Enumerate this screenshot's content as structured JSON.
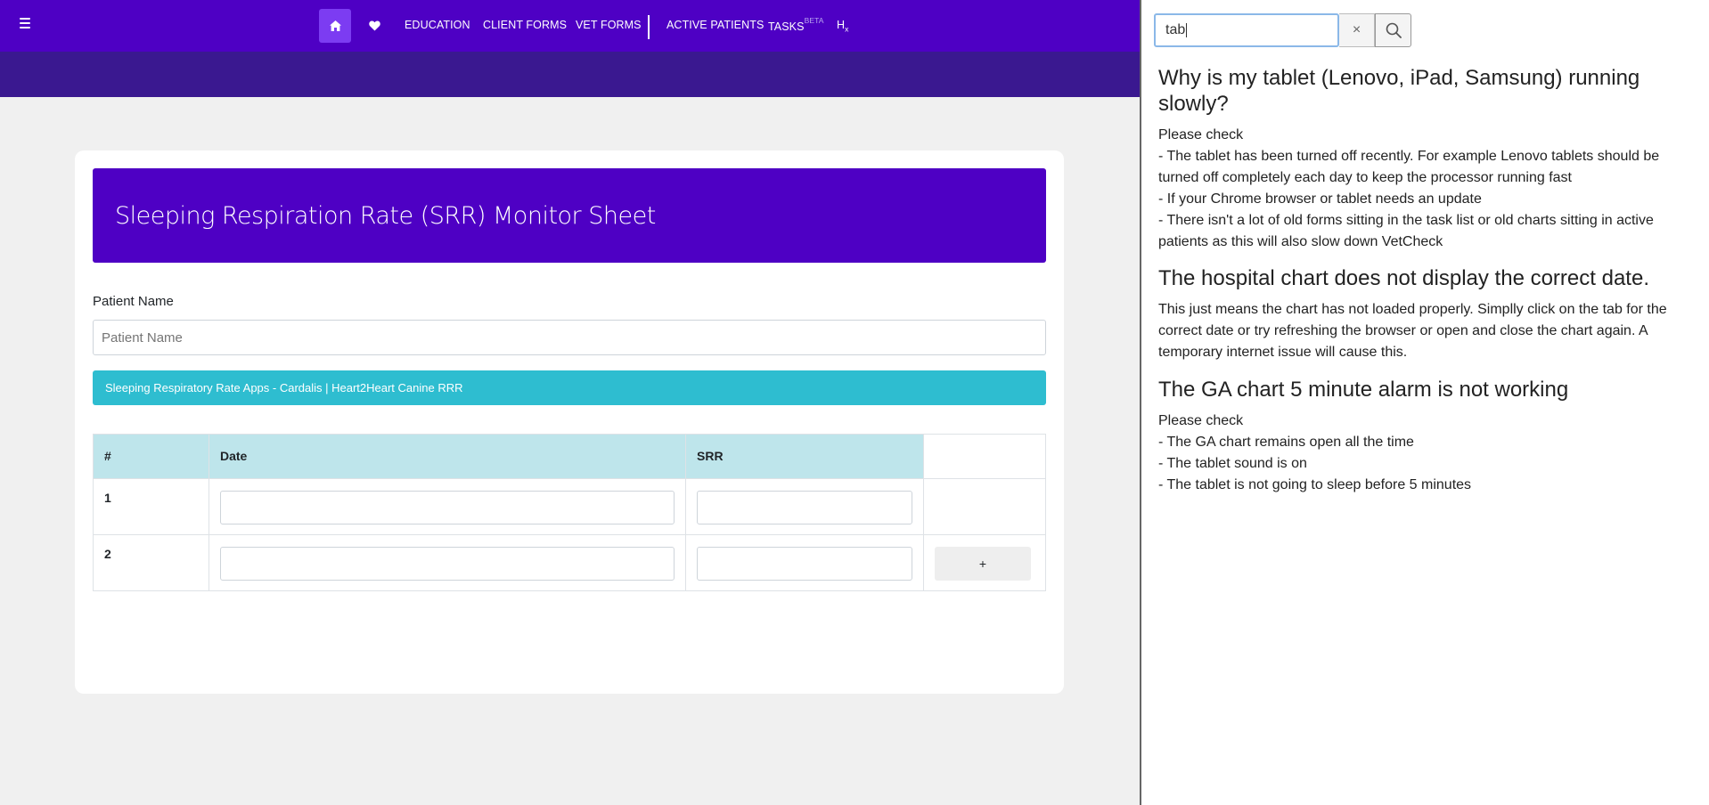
{
  "nav": {
    "items": [
      "EDUCATION",
      "CLIENT FORMS",
      "VET FORMS",
      "ACTIVE PATIENTS"
    ],
    "tasks_label": "TASKS",
    "tasks_badge": "BETA",
    "hx_label": "H",
    "hx_sub": "x"
  },
  "form": {
    "title": "Sleeping Respiration Rate (SRR) Monitor Sheet",
    "patient_label": "Patient Name",
    "patient_placeholder": "Patient Name",
    "apps_button": "Sleeping Respiratory Rate Apps - Cardalis | Heart2Heart Canine RRR",
    "table": {
      "headers": [
        "#",
        "Date",
        "SRR",
        ""
      ],
      "rows": [
        {
          "num": "1",
          "date": "",
          "srr": ""
        },
        {
          "num": "2",
          "date": "",
          "srr": ""
        }
      ],
      "add_label": "+"
    }
  },
  "help": {
    "search_value": "tab",
    "clear_label": "×",
    "faqs": [
      {
        "title": "Why is my tablet (Lenovo, iPad, Samsung) running slowly?",
        "lines": [
          "Please check",
          "- The tablet has been turned off recently. For example Lenovo tablets should be turned off completely each day to keep the processor running fast",
          "- If your Chrome browser or tablet needs an update",
          "- There isn't a lot of old forms sitting in the task list or old charts sitting in active patients as this will also slow down VetCheck"
        ]
      },
      {
        "title": "The hospital chart does not display the correct date.",
        "lines": [
          "This just means the chart has not loaded properly. Simplly click on the tab for the correct date or try refreshing the browser or open and close the chart again. A temporary internet issue will cause this."
        ]
      },
      {
        "title": "The GA chart 5 minute alarm is not working",
        "lines": [
          "Please check",
          "- The GA chart remains open all the time",
          "- The tablet sound is on",
          "- The tablet is not going to sleep before 5 minutes"
        ]
      }
    ]
  },
  "colors": {
    "nav_bg": "#4e00c4",
    "subbar_bg": "#3a1890",
    "home_active": "#7c3cf2",
    "teal": "#2ebdd0",
    "table_header": "#bee5eb"
  }
}
